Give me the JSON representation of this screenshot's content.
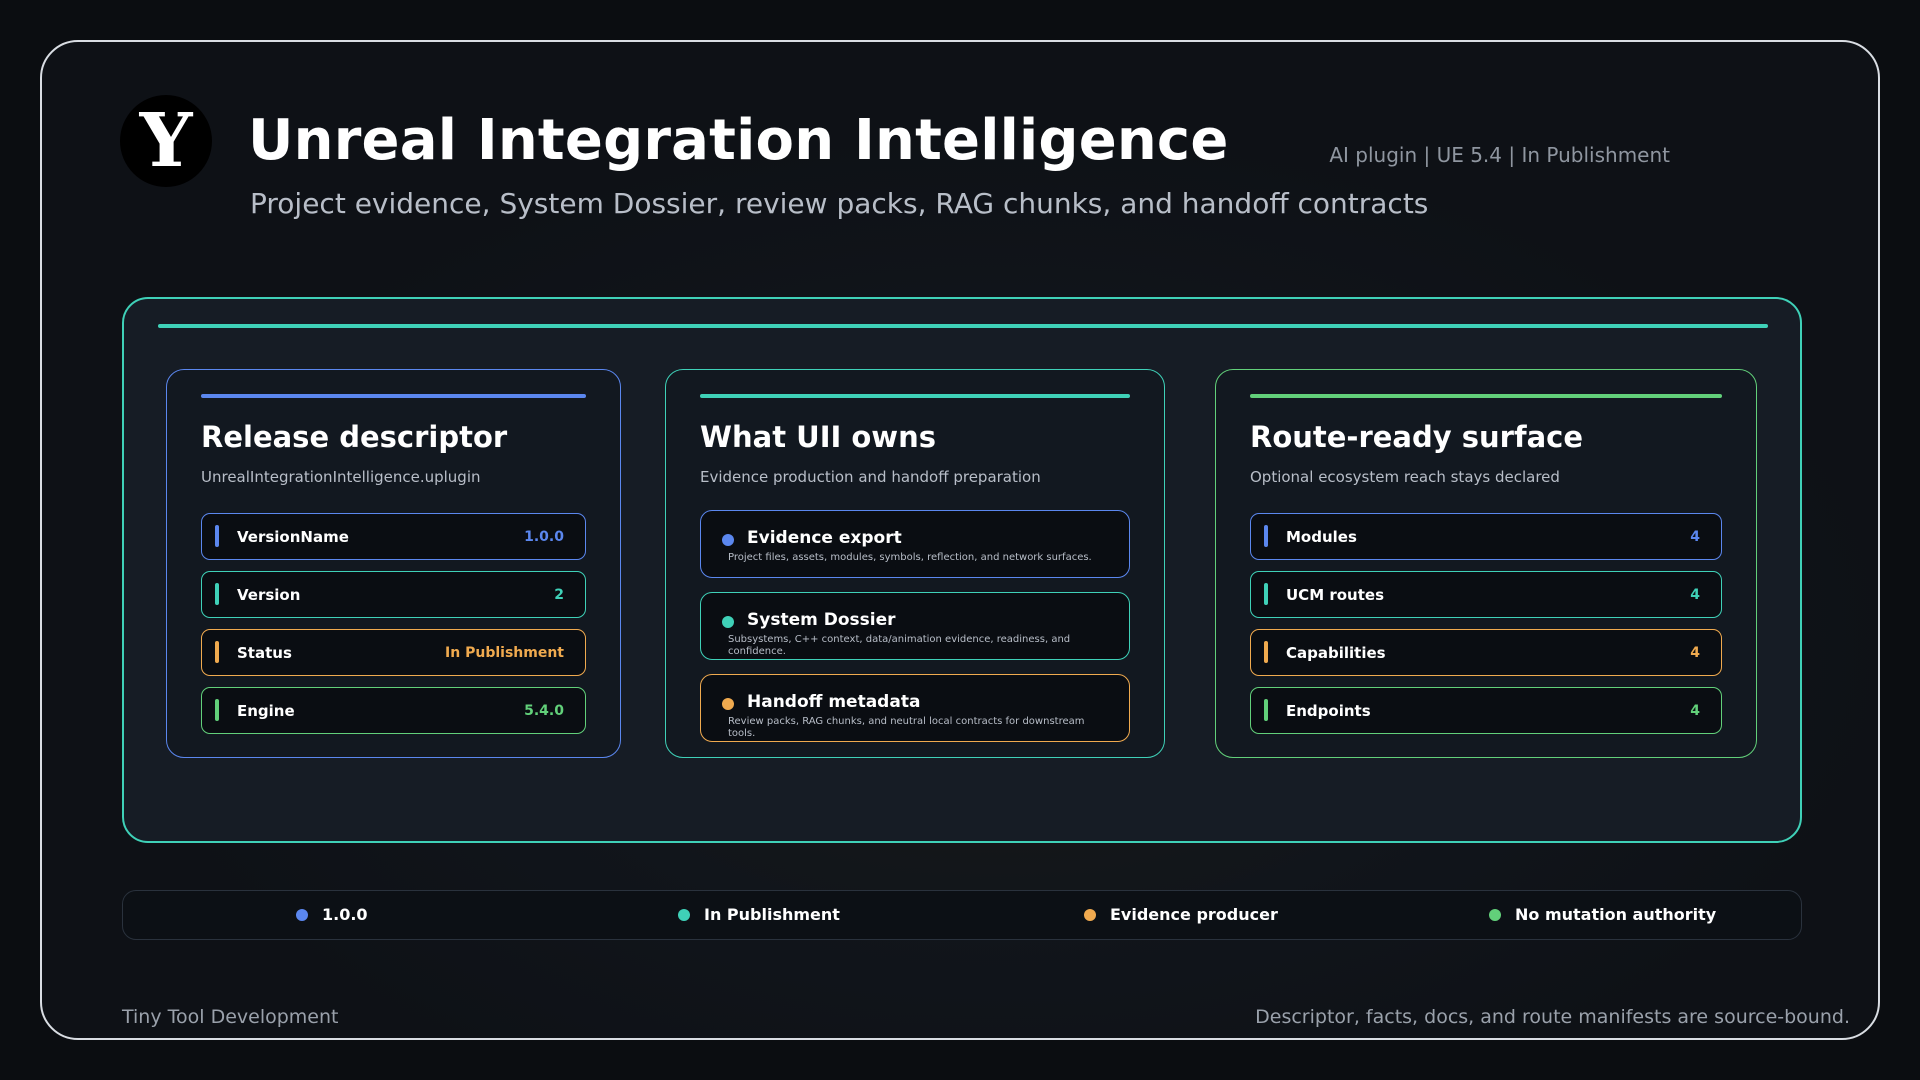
{
  "header": {
    "logo_letter": "Y",
    "title": "Unreal Integration Intelligence",
    "subtitle": "Project evidence, System Dossier, review packs, RAG chunks, and handoff contracts",
    "meta": "AI plugin  |  UE 5.4  |  In Publishment"
  },
  "colors": {
    "blue": "#5b87ef",
    "teal": "#3fd1b8",
    "orange": "#f0aa4f",
    "green": "#62d07a"
  },
  "cards": {
    "release": {
      "title": "Release descriptor",
      "subtitle": "UnrealIntegrationIntelligence.uplugin",
      "rows": [
        {
          "label": "VersionName",
          "value": "1.0.0"
        },
        {
          "label": "Version",
          "value": "2"
        },
        {
          "label": "Status",
          "value": "In Publishment"
        },
        {
          "label": "Engine",
          "value": "5.4.0"
        }
      ]
    },
    "owns": {
      "title": "What UII owns",
      "subtitle": "Evidence production and handoff preparation",
      "items": [
        {
          "title": "Evidence export",
          "desc": "Project files, assets, modules, symbols, reflection, and network surfaces."
        },
        {
          "title": "System Dossier",
          "desc": "Subsystems, C++ context, data/animation evidence, readiness, and confidence."
        },
        {
          "title": "Handoff metadata",
          "desc": "Review packs, RAG chunks, and neutral local contracts for downstream tools."
        }
      ]
    },
    "route": {
      "title": "Route-ready surface",
      "subtitle": "Optional ecosystem reach stays declared",
      "rows": [
        {
          "label": "Modules",
          "value": "4"
        },
        {
          "label": "UCM routes",
          "value": "4"
        },
        {
          "label": "Capabilities",
          "value": "4"
        },
        {
          "label": "Endpoints",
          "value": "4"
        }
      ]
    }
  },
  "status_strip": [
    {
      "label": "1.0.0"
    },
    {
      "label": "In Publishment"
    },
    {
      "label": "Evidence producer"
    },
    {
      "label": "No mutation authority"
    }
  ],
  "footer": {
    "left": "Tiny Tool Development",
    "right": "Descriptor, facts, docs, and route manifests are source-bound."
  }
}
